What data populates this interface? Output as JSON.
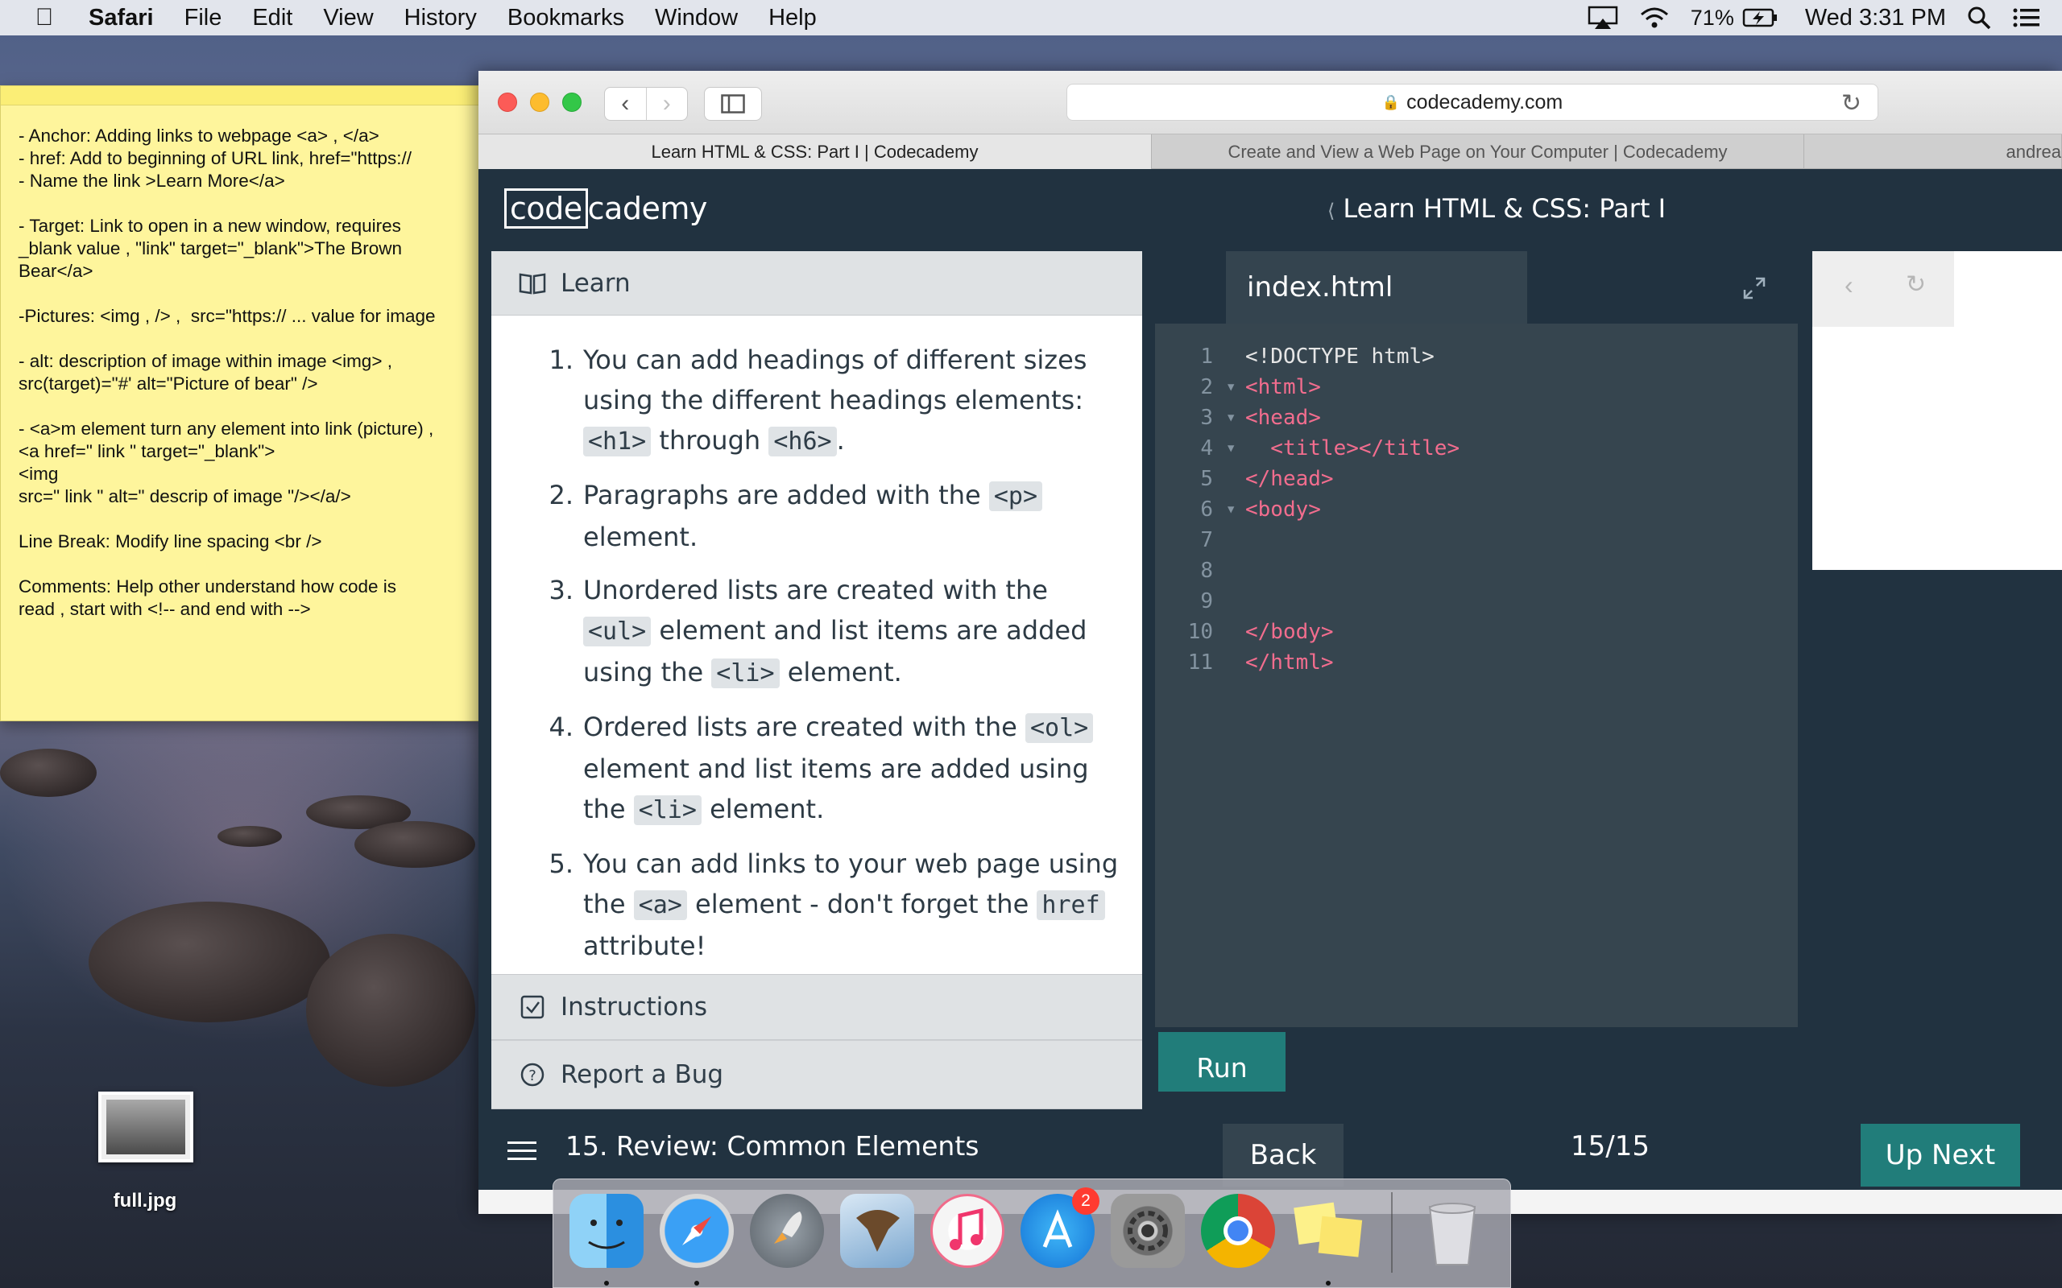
{
  "menubar": {
    "app": "Safari",
    "items": [
      "File",
      "Edit",
      "View",
      "History",
      "Bookmarks",
      "Window",
      "Help"
    ],
    "battery": "71%",
    "clock": "Wed 3:31 PM"
  },
  "sticky": {
    "lines": [
      "- Anchor: Adding links to webpage <a> , </a>",
      "- href: Add to beginning of URL link, href=\"https://",
      "- Name the link >Learn More</a>",
      "",
      "- Target: Link to open in a new window, requires",
      "_blank value , \"link\" target=\"_blank\">The Brown",
      "Bear</a>",
      "",
      "-Pictures: <img , /> ,  src=\"https:// ... value for image",
      "",
      "- alt: description of image within image <img> ,",
      "src(target)=\"#' alt=\"Picture of bear\" />",
      "",
      "- <a>m element turn any element into link (picture) ,",
      "<a href=\" link \" target=\"_blank\">",
      "<img",
      "src=\" link \" alt=\" descrip of image \"/></a/>",
      "",
      "Line Break: Modify line spacing <br />",
      "",
      "Comments: Help other understand how code is",
      "read , start with <!-- and end with -->"
    ]
  },
  "desktop_file": {
    "label": "full.jpg"
  },
  "safari": {
    "address": "codecademy.com",
    "tabs": [
      "Learn HTML & CSS: Part I | Codecademy",
      "Create and View a Web Page on Your Computer | Codecademy",
      "andrea"
    ]
  },
  "app": {
    "logo_boxed": "code",
    "logo_rest": "cademy",
    "course_title": "Learn HTML & CSS: Part I",
    "learn_label": "Learn",
    "instructions_label": "Instructions",
    "report_label": "Report a Bug",
    "lesson_items": [
      {
        "num": "1.",
        "parts": [
          {
            "t": "text",
            "v": "You can add headings of different sizes using the different headings elements: "
          },
          {
            "t": "code",
            "v": "<h1>"
          },
          {
            "t": "text",
            "v": " through "
          },
          {
            "t": "code",
            "v": "<h6>"
          },
          {
            "t": "text",
            "v": "."
          }
        ]
      },
      {
        "num": "2.",
        "parts": [
          {
            "t": "text",
            "v": "Paragraphs are added with the "
          },
          {
            "t": "code",
            "v": "<p>"
          },
          {
            "t": "text",
            "v": " element."
          }
        ]
      },
      {
        "num": "3.",
        "parts": [
          {
            "t": "text",
            "v": "Unordered lists are created with the "
          },
          {
            "t": "code",
            "v": "<ul>"
          },
          {
            "t": "text",
            "v": " element and list items are added using the "
          },
          {
            "t": "code",
            "v": "<li>"
          },
          {
            "t": "text",
            "v": " element."
          }
        ]
      },
      {
        "num": "4.",
        "parts": [
          {
            "t": "text",
            "v": "Ordered lists are created with the "
          },
          {
            "t": "code",
            "v": "<ol>"
          },
          {
            "t": "text",
            "v": " element and list items are added using the "
          },
          {
            "t": "code",
            "v": "<li>"
          },
          {
            "t": "text",
            "v": " element."
          }
        ]
      },
      {
        "num": "5.",
        "parts": [
          {
            "t": "text",
            "v": "You can add links to your web page using the "
          },
          {
            "t": "code",
            "v": "<a>"
          },
          {
            "t": "text",
            "v": " element - don't forget the "
          },
          {
            "t": "code",
            "v": "href"
          },
          {
            "t": "text",
            "v": " attribute!"
          }
        ]
      }
    ],
    "editor": {
      "file_tab": "index.html",
      "lines": [
        {
          "n": "1",
          "fold": false,
          "text": "<!DOCTYPE html>",
          "color": "#e6e6e6"
        },
        {
          "n": "2",
          "fold": true,
          "text": "<html>",
          "color": "#f26d8e"
        },
        {
          "n": "3",
          "fold": true,
          "text": "<head>",
          "color": "#f26d8e"
        },
        {
          "n": "4",
          "fold": true,
          "text": "  <title></title>",
          "color": "#f26d8e"
        },
        {
          "n": "5",
          "fold": false,
          "text": "</head>",
          "color": "#f26d8e"
        },
        {
          "n": "6",
          "fold": true,
          "text": "<body>",
          "color": "#f26d8e"
        },
        {
          "n": "7",
          "fold": false,
          "text": "",
          "color": "#f26d8e"
        },
        {
          "n": "8",
          "fold": false,
          "text": "",
          "color": "#f26d8e"
        },
        {
          "n": "9",
          "fold": false,
          "text": "",
          "color": "#f26d8e"
        },
        {
          "n": "10",
          "fold": false,
          "text": "</body>",
          "color": "#f26d8e"
        },
        {
          "n": "11",
          "fold": false,
          "text": "</html>",
          "color": "#f26d8e"
        }
      ],
      "run_label": "Run"
    },
    "bottom": {
      "lesson_name": "15. Review: Common Elements",
      "back_label": "Back",
      "counter": "15/15",
      "next_label": "Up Next"
    }
  },
  "dock": {
    "apps": [
      {
        "name": "finder-icon",
        "running": true
      },
      {
        "name": "safari-icon",
        "running": true
      },
      {
        "name": "launchpad-icon",
        "running": false
      },
      {
        "name": "mail-icon",
        "running": false
      },
      {
        "name": "itunes-icon",
        "running": false
      },
      {
        "name": "app-store-icon",
        "running": false,
        "badge": "2"
      },
      {
        "name": "system-preferences-icon",
        "running": false
      },
      {
        "name": "chrome-icon",
        "running": false
      },
      {
        "name": "stickies-icon",
        "running": true
      },
      {
        "name": "trash-icon",
        "running": false
      }
    ]
  }
}
